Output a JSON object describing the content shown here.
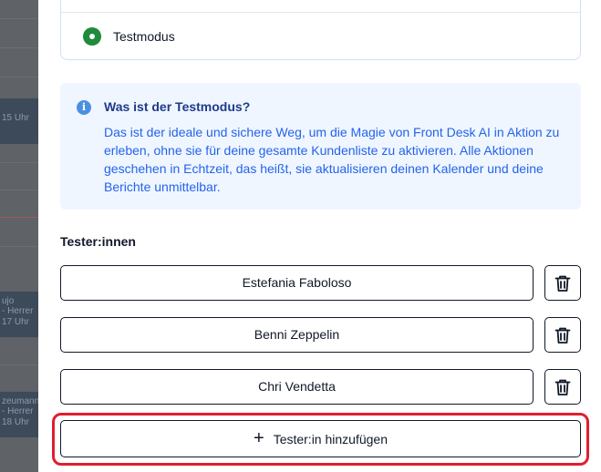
{
  "background": {
    "event_times": [
      "15 Uhr",
      "17 Uhr",
      "18 Uhr"
    ],
    "event_names": [
      "ujo",
      "- Herrer",
      "zeumann",
      "- Herrer"
    ]
  },
  "mode": {
    "label": "Testmodus",
    "selected": true,
    "accent": "#1f8b3b"
  },
  "info": {
    "title": "Was ist der Testmodus?",
    "body": "Das ist der ideale und sichere Weg, um die Magie von Front Desk AI in Aktion zu erleben, ohne sie für deine gesamte Kundenliste zu aktivieren. Alle Aktionen geschehen in Echtzeit, das heißt, sie aktualisieren deinen Kalender und deine Berichte unmittelbar."
  },
  "testers": {
    "heading": "Tester:innen",
    "items": [
      {
        "name": "Estefania Faboloso"
      },
      {
        "name": "Benni Zeppelin"
      },
      {
        "name": "Chri Vendetta"
      }
    ],
    "add_label": "Tester:in hinzufügen"
  },
  "colors": {
    "highlight": "#e01e2f",
    "info_bg": "#eff6ff",
    "info_text": "#2563eb"
  }
}
